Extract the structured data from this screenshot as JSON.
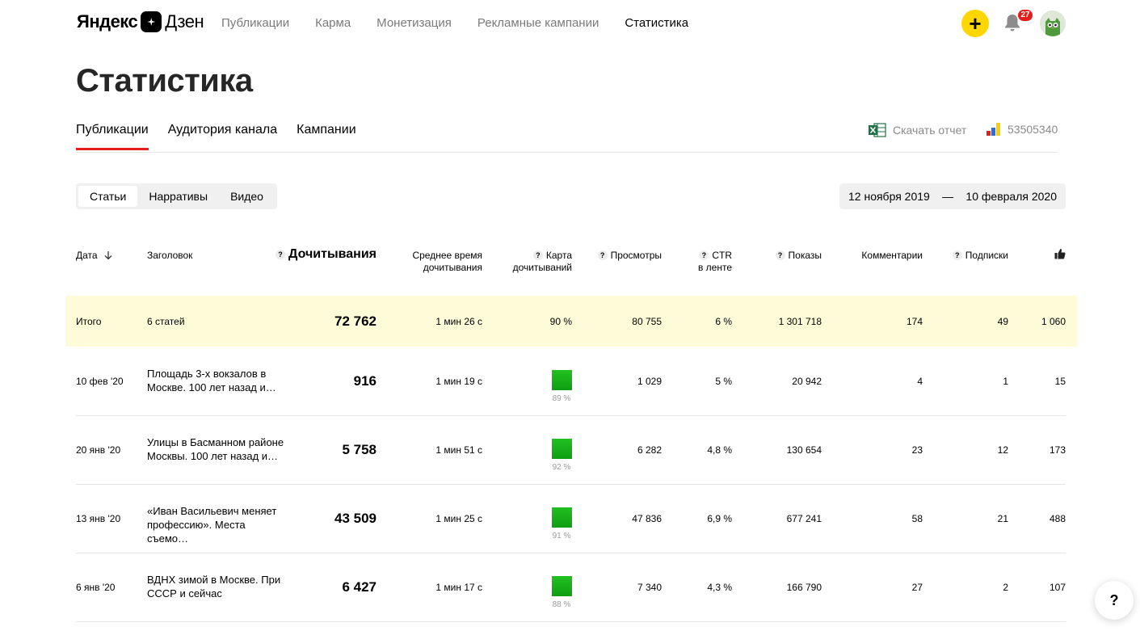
{
  "header": {
    "logo_part1": "Яндекс",
    "logo_part2": "Дзен",
    "nav": [
      "Публикации",
      "Карма",
      "Монетизация",
      "Рекламные кампании",
      "Статистика"
    ],
    "active_nav": "Статистика",
    "notifications_count": "27",
    "add_label": "+"
  },
  "page_title": "Статистика",
  "tabs": [
    "Публикации",
    "Аудитория канала",
    "Кампании"
  ],
  "active_tab": "Публикации",
  "download_label": "Скачать отчет",
  "counter_id": "53505340",
  "segments": [
    "Статьи",
    "Нарративы",
    "Видео"
  ],
  "active_segment": "Статьи",
  "date_from": "12 ноября 2019",
  "date_sep": "—",
  "date_to": "10 февраля 2020",
  "table": {
    "headers": {
      "date": "Дата",
      "title": "Заголовок",
      "reads": "Дочитывания",
      "avg_time_1": "Среднее время",
      "avg_time_2": "дочитывания",
      "map_1": "Карта",
      "map_2": "дочитываний",
      "views": "Просмотры",
      "ctr_1": "CTR",
      "ctr_2": "в ленте",
      "impressions": "Показы",
      "comments": "Комментарии",
      "subs": "Подписки",
      "q": "?"
    },
    "total": {
      "label": "Итого",
      "title": "6 статей",
      "reads": "72 762",
      "avg_time": "1 мин 26 с",
      "map": "90 %",
      "views": "80 755",
      "ctr": "6 %",
      "impressions": "1 301 718",
      "comments": "174",
      "subs": "49",
      "likes": "1 060"
    },
    "rows": [
      {
        "date": "10 фев '20",
        "title": "Площадь 3-х вокзалов в Москве. 100 лет назад и…",
        "reads": "916",
        "avg_time": "1 мин 19 с",
        "map": "89 %",
        "views": "1 029",
        "ctr": "5 %",
        "impressions": "20 942",
        "comments": "4",
        "subs": "1",
        "likes": "15"
      },
      {
        "date": "20 янв '20",
        "title": "Улицы в Басманном районе Москвы. 100 лет назад и…",
        "reads": "5 758",
        "avg_time": "1 мин 51 с",
        "map": "92 %",
        "views": "6 282",
        "ctr": "4,8 %",
        "impressions": "130 654",
        "comments": "23",
        "subs": "12",
        "likes": "173"
      },
      {
        "date": "13 янв '20",
        "title": "«Иван Васильевич меняет профессию». Места съемо…",
        "reads": "43 509",
        "avg_time": "1 мин 25 с",
        "map": "91 %",
        "views": "47 836",
        "ctr": "6,9 %",
        "impressions": "677 241",
        "comments": "58",
        "subs": "21",
        "likes": "488"
      },
      {
        "date": "6 янв '20",
        "title": "ВДНХ зимой в Москве. При СССР и сейчас",
        "reads": "6 427",
        "avg_time": "1 мин 17 с",
        "map": "88 %",
        "views": "7 340",
        "ctr": "4,3 %",
        "impressions": "166 790",
        "comments": "27",
        "subs": "2",
        "likes": "107"
      }
    ]
  },
  "help_label": "?",
  "colors": {
    "accent_yellow": "#ffd600",
    "tab_red": "#e51d1d",
    "total_bg": "#fefbd8",
    "map_green": "#22c022"
  }
}
